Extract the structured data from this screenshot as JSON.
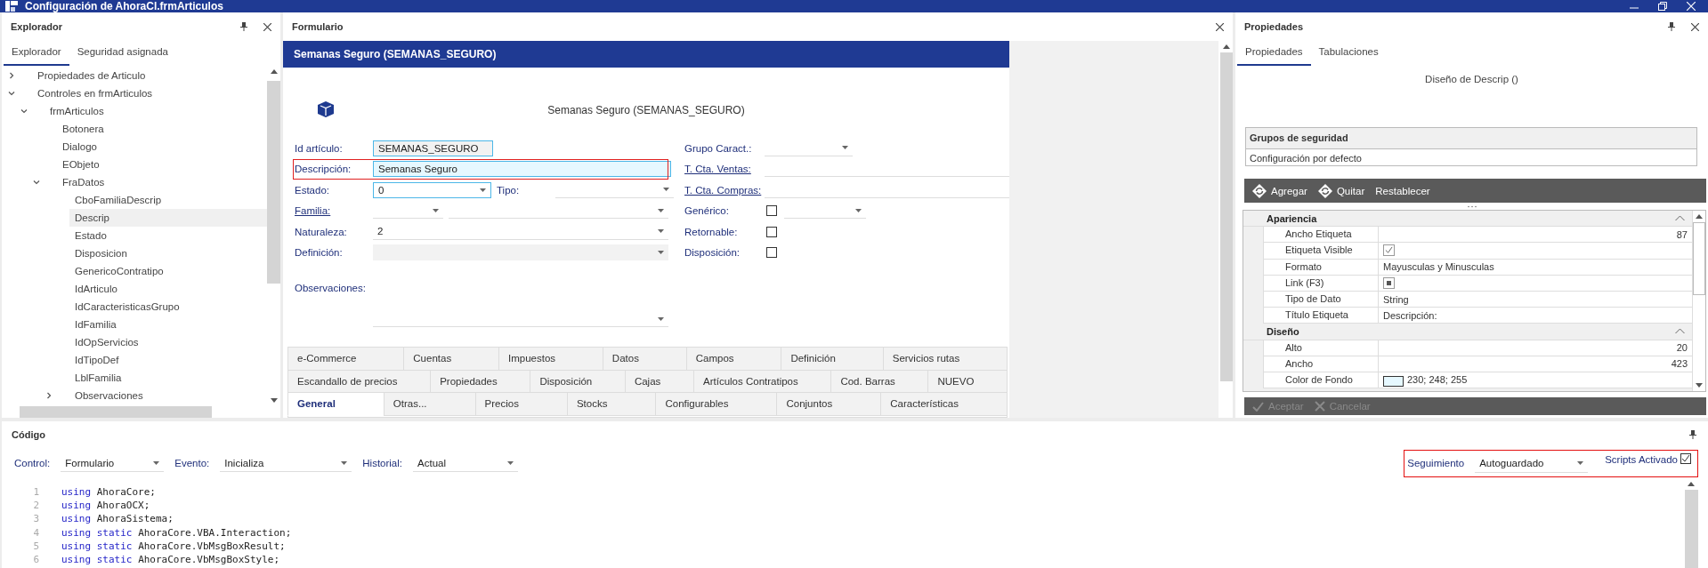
{
  "window": {
    "title": "Configuración de AhoraCl.frmArticulos"
  },
  "explorer": {
    "title": "Explorador",
    "tabs": [
      {
        "label": "Explorador",
        "selected": true
      },
      {
        "label": "Seguridad asignada",
        "selected": false
      }
    ],
    "tree": [
      {
        "label": "Propiedades de Articulo",
        "expanded": false,
        "selected": false
      },
      {
        "label": "Controles en frmArticulos",
        "expanded": true,
        "selected": false,
        "children": [
          {
            "label": "frmArticulos",
            "expanded": true,
            "selected": false,
            "children": [
              {
                "label": "Botonera",
                "selected": false
              },
              {
                "label": "Dialogo",
                "selected": false
              },
              {
                "label": "EObjeto",
                "selected": false
              },
              {
                "label": "FraDatos",
                "expanded": true,
                "selected": false,
                "children": [
                  {
                    "label": "CboFamiliaDescrip",
                    "selected": false
                  },
                  {
                    "label": "Descrip",
                    "selected": true
                  },
                  {
                    "label": "Estado",
                    "selected": false
                  },
                  {
                    "label": "Disposicion",
                    "selected": false
                  },
                  {
                    "label": "GenericoContratipo",
                    "selected": false
                  },
                  {
                    "label": "IdArticulo",
                    "selected": false
                  },
                  {
                    "label": "IdCaracteristicasGrupo",
                    "selected": false
                  },
                  {
                    "label": "IdFamilia",
                    "selected": false
                  },
                  {
                    "label": "IdOpServicios",
                    "selected": false
                  },
                  {
                    "label": "IdTipoDef",
                    "selected": false
                  },
                  {
                    "label": "LblFamilia",
                    "selected": false
                  },
                  {
                    "label": "Observaciones",
                    "expanded": false,
                    "selected": false
                  }
                ]
              }
            ]
          }
        ]
      }
    ]
  },
  "form": {
    "title": "Formulario",
    "header": "Semanas Seguro (SEMANAS_SEGURO)",
    "caption": "Semanas Seguro (SEMANAS_SEGURO)",
    "fields_left": [
      {
        "label": "Id artículo:",
        "link": false,
        "selected": false,
        "controls": [
          {
            "kind": "text",
            "value": "SEMANAS_SEGURO",
            "readonly": true,
            "focused": true
          }
        ]
      },
      {
        "label": "Descripción:",
        "link": false,
        "selected": true,
        "controls": [
          {
            "kind": "text",
            "value": "Semanas Seguro",
            "readonly": false,
            "focused": true
          }
        ]
      },
      {
        "label": "Estado:",
        "link": false,
        "selected": false,
        "controls": [
          {
            "kind": "combo",
            "value": "0",
            "focused": true,
            "disabled": false
          },
          {
            "kind": "label",
            "text": "Tipo:"
          },
          {
            "kind": "combo",
            "focused": false,
            "disabled": false
          }
        ]
      },
      {
        "label": "Familia:",
        "link": true,
        "selected": false,
        "controls": [
          {
            "kind": "combo",
            "focused": false,
            "disabled": false
          },
          {
            "kind": "combo",
            "focused": false,
            "disabled": false
          }
        ]
      },
      {
        "label": "Naturaleza:",
        "link": false,
        "selected": false,
        "controls": [
          {
            "kind": "combo",
            "value": "2",
            "focused": false,
            "disabled": false
          }
        ]
      },
      {
        "label": "Definición:",
        "link": false,
        "selected": false,
        "controls": [
          {
            "kind": "combo",
            "focused": false,
            "disabled": true
          }
        ]
      },
      {
        "label": "Observaciones:",
        "link": false,
        "selected": false,
        "controls": [
          {
            "kind": "memo"
          }
        ]
      }
    ],
    "fields_right": [
      {
        "label": "Grupo Caract.:",
        "link": false,
        "controls": [
          {
            "kind": "combo",
            "focused": false,
            "disabled": false
          }
        ]
      },
      {
        "label": "T. Cta. Ventas:",
        "link": true,
        "controls": [
          {
            "kind": "line"
          }
        ]
      },
      {
        "label": "T. Cta. Compras:",
        "link": true,
        "controls": [
          {
            "kind": "line"
          }
        ]
      },
      {
        "label": "Genérico:",
        "link": false,
        "controls": [
          {
            "kind": "checkbox",
            "checked": false
          },
          {
            "kind": "combo",
            "focused": false,
            "disabled": false
          }
        ]
      },
      {
        "label": "Retornable:",
        "link": false,
        "controls": [
          {
            "kind": "checkbox",
            "checked": false
          }
        ]
      },
      {
        "label": "Disposición:",
        "link": false,
        "controls": [
          {
            "kind": "checkbox",
            "checked": false
          }
        ]
      }
    ],
    "tab_rows": [
      [
        {
          "label": "e-Commerce",
          "selected": false
        },
        {
          "label": "Cuentas",
          "selected": false
        },
        {
          "label": "Impuestos",
          "selected": false
        },
        {
          "label": "Datos",
          "selected": false
        },
        {
          "label": "Campos",
          "selected": false
        },
        {
          "label": "Definición",
          "selected": false
        },
        {
          "label": "Servicios rutas",
          "selected": false
        }
      ],
      [
        {
          "label": "Escandallo de precios",
          "selected": false
        },
        {
          "label": "Propiedades",
          "selected": false
        },
        {
          "label": "Disposición",
          "selected": false
        },
        {
          "label": "Cajas",
          "selected": false
        },
        {
          "label": "Artículos Contratipos",
          "selected": false
        },
        {
          "label": "Cod. Barras",
          "selected": false
        },
        {
          "label": "NUEVO",
          "selected": false
        }
      ],
      [
        {
          "label": "General",
          "selected": true
        },
        {
          "label": "Otras...",
          "selected": false
        },
        {
          "label": "Precios",
          "selected": false
        },
        {
          "label": "Stocks",
          "selected": false
        },
        {
          "label": "Configurables",
          "selected": false
        },
        {
          "label": "Conjuntos",
          "selected": false
        },
        {
          "label": "Características",
          "selected": false
        }
      ]
    ]
  },
  "properties": {
    "title": "Propiedades",
    "tabs": [
      {
        "label": "Propiedades",
        "selected": true
      },
      {
        "label": "Tabulaciones",
        "selected": false
      }
    ],
    "design_title": "Diseño de Descrip ()",
    "security": {
      "title": "Grupos de seguridad",
      "value": "Configuración por defecto"
    },
    "toolbar": [
      {
        "label": "Agregar",
        "icon": true
      },
      {
        "label": "Quitar",
        "icon": true
      },
      {
        "label": "Restablecer",
        "icon": false
      }
    ],
    "groups": [
      {
        "title": "Apariencia",
        "expanded": true,
        "rows": [
          {
            "name": "Ancho Etiqueta",
            "kind": "number",
            "value": "87"
          },
          {
            "name": "Etiqueta Visible",
            "kind": "check",
            "checked": true
          },
          {
            "name": "Formato",
            "kind": "text",
            "value": "Mayusculas y Minusculas"
          },
          {
            "name": "Link (F3)",
            "kind": "check",
            "indeterminate": true
          },
          {
            "name": "Tipo de Dato",
            "kind": "text",
            "value": "String"
          },
          {
            "name": "Título Etiqueta",
            "kind": "text",
            "value": "Descripción:"
          }
        ]
      },
      {
        "title": "Diseño",
        "expanded": true,
        "rows": [
          {
            "name": "Alto",
            "kind": "number",
            "value": "20"
          },
          {
            "name": "Ancho",
            "kind": "number",
            "value": "423"
          },
          {
            "name": "Color de Fondo",
            "kind": "color",
            "color": "#e6f8ff",
            "value": "230; 248; 255"
          }
        ]
      }
    ],
    "actions": [
      {
        "label": "Aceptar",
        "disabled": true
      },
      {
        "label": "Cancelar",
        "disabled": true
      }
    ]
  },
  "code": {
    "title": "Código",
    "selectors": [
      {
        "label": "Control:",
        "value": "Formulario"
      },
      {
        "label": "Evento:",
        "value": "Inicializa"
      },
      {
        "label": "Historial:",
        "value": "Actual"
      }
    ],
    "tracking": {
      "highlighted": true,
      "label": "Seguimiento",
      "value": "Autoguardado",
      "scripts_label": "Scripts Activado",
      "scripts_checked": true
    },
    "lines": [
      {
        "number": "1",
        "tokens": [
          {
            "kind": "keyword",
            "text": "using"
          },
          {
            "kind": "plain",
            "text": "AhoraCore;"
          }
        ]
      },
      {
        "number": "2",
        "tokens": [
          {
            "kind": "keyword",
            "text": "using"
          },
          {
            "kind": "plain",
            "text": "AhoraOCX;"
          }
        ]
      },
      {
        "number": "3",
        "tokens": [
          {
            "kind": "keyword",
            "text": "using"
          },
          {
            "kind": "plain",
            "text": "AhoraSistema;"
          }
        ]
      },
      {
        "number": "4",
        "tokens": [
          {
            "kind": "keyword",
            "text": "using"
          },
          {
            "kind": "keyword",
            "text": "static"
          },
          {
            "kind": "plain",
            "text": "AhoraCore.VBA.Interaction;"
          }
        ]
      },
      {
        "number": "5",
        "tokens": [
          {
            "kind": "keyword",
            "text": "using"
          },
          {
            "kind": "keyword",
            "text": "static"
          },
          {
            "kind": "plain",
            "text": "AhoraCore.VbMsgBoxResult;"
          }
        ]
      },
      {
        "number": "6",
        "tokens": [
          {
            "kind": "keyword",
            "text": "using"
          },
          {
            "kind": "keyword",
            "text": "static"
          },
          {
            "kind": "plain",
            "text": "AhoraCore.VbMsgBoxStyle;"
          }
        ]
      }
    ]
  }
}
